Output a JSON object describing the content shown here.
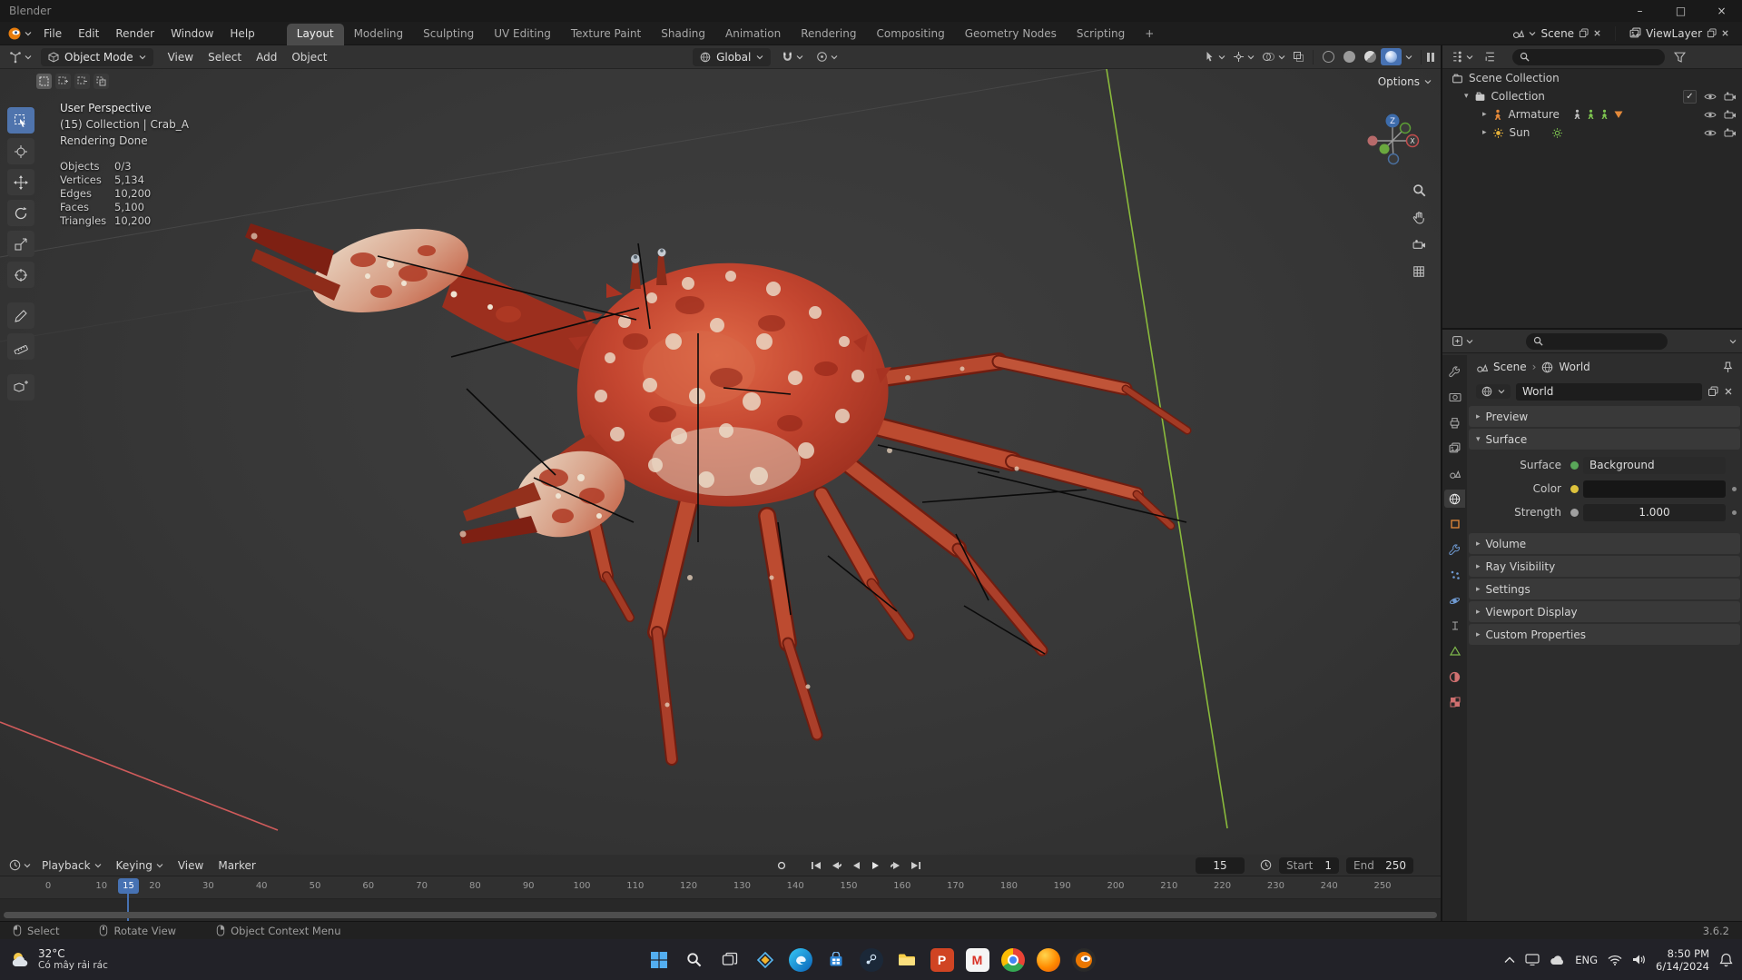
{
  "window": {
    "title": "Blender",
    "minimize": "–",
    "maximize": "□",
    "close": "×"
  },
  "menubar": {
    "menus": [
      "File",
      "Edit",
      "Render",
      "Window",
      "Help"
    ],
    "workspaces": [
      "Layout",
      "Modeling",
      "Sculpting",
      "UV Editing",
      "Texture Paint",
      "Shading",
      "Animation",
      "Rendering",
      "Compositing",
      "Geometry Nodes",
      "Scripting"
    ],
    "add_tab": "+",
    "scene_label": "Scene",
    "viewlayer_label": "ViewLayer"
  },
  "viewport_header": {
    "mode": "Object Mode",
    "menus": [
      "View",
      "Select",
      "Add",
      "Object"
    ],
    "orientation": "Global",
    "options": "Options"
  },
  "viewport_overlay": {
    "perspective": "User Perspective",
    "context": "(15) Collection | Crab_A",
    "status": "Rendering Done",
    "stats": [
      {
        "label": "Objects",
        "value": "0/3"
      },
      {
        "label": "Vertices",
        "value": "5,134"
      },
      {
        "label": "Edges",
        "value": "10,200"
      },
      {
        "label": "Faces",
        "value": "5,100"
      },
      {
        "label": "Triangles",
        "value": "10,200"
      }
    ],
    "axis_z": "Z",
    "axis_x": "X"
  },
  "outliner": {
    "root": "Scene Collection",
    "items": [
      {
        "label": "Collection"
      },
      {
        "label": "Armature"
      },
      {
        "label": "Sun"
      }
    ]
  },
  "properties": {
    "breadcrumb_scene": "Scene",
    "breadcrumb_world": "World",
    "datablock": "World",
    "panels": [
      "Preview",
      "Surface",
      "Volume",
      "Ray Visibility",
      "Settings",
      "Viewport Display",
      "Custom Properties"
    ],
    "surface_label": "Surface",
    "surface_value": "Background",
    "color_label": "Color",
    "strength_label": "Strength",
    "strength_value": "1.000",
    "accent_color": "#4772b3",
    "socket_shader_color": "#59a659",
    "socket_color_color": "#ddc23c",
    "socket_value_color": "#a0a0a0"
  },
  "timeline": {
    "menus": [
      "Playback",
      "Keying",
      "View",
      "Marker"
    ],
    "current_frame": "15",
    "start_label": "Start",
    "start_value": "1",
    "end_label": "End",
    "end_value": "250",
    "ticks": [
      "0",
      "10",
      "20",
      "30",
      "40",
      "50",
      "60",
      "70",
      "80",
      "90",
      "100",
      "110",
      "120",
      "130",
      "140",
      "150",
      "160",
      "170",
      "180",
      "190",
      "200",
      "210",
      "220",
      "230",
      "240",
      "250"
    ]
  },
  "statusbar": {
    "hints": [
      "Select",
      "Rotate View",
      "Object Context Menu"
    ],
    "version": "3.6.2"
  },
  "taskbar": {
    "weather_temp": "32°C",
    "weather_desc": "Có mây rải rác",
    "language": "ENG",
    "time": "8:50 PM",
    "date": "6/14/2024",
    "icons": [
      "start",
      "search",
      "task-view",
      "photos",
      "edge",
      "store",
      "steam",
      "file-explorer",
      "powerpoint",
      "gmail",
      "chrome",
      "firefox",
      "blender"
    ]
  }
}
